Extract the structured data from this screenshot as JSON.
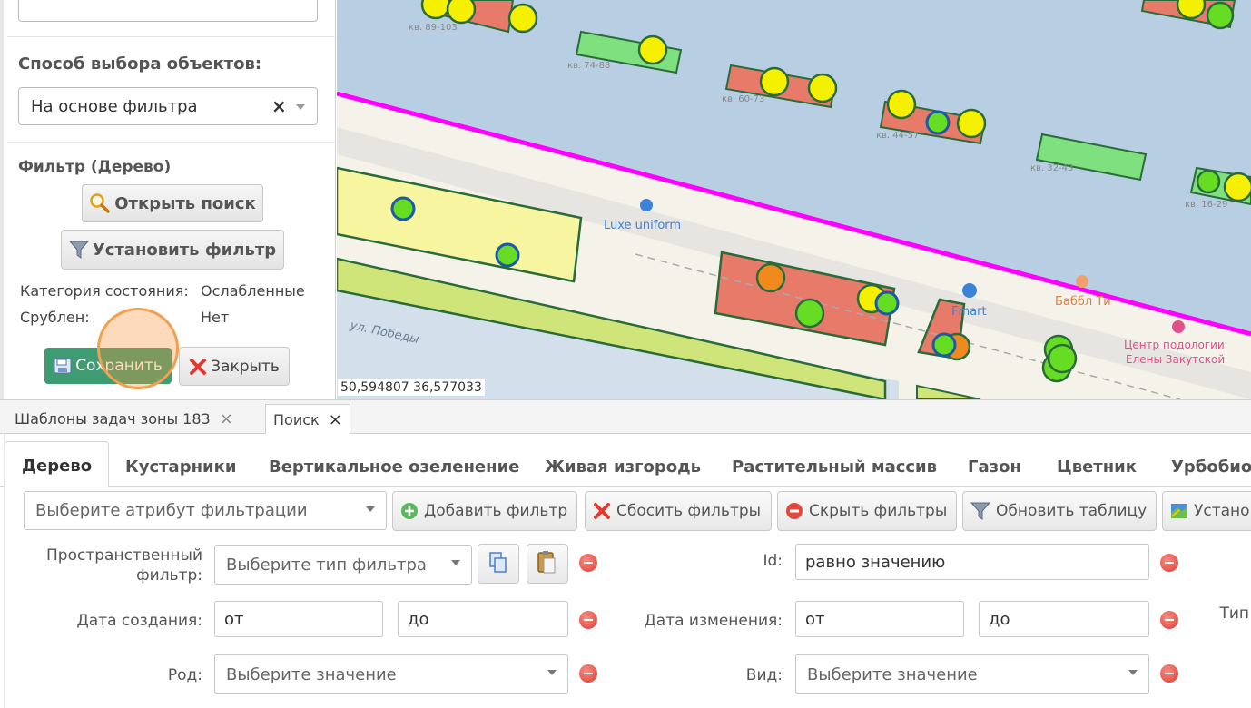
{
  "left_panel": {
    "selection_method_title": "Способ выбора объектов:",
    "selection_method_value": "На основе фильтра",
    "selection_method_clear": "×",
    "filter_title": "Фильтр (Дерево)",
    "open_search_label": "Открыть поиск",
    "set_filter_label": "Установить фильтр",
    "state_category_key": "Категория состояния:",
    "state_category_value": "Ослабленные",
    "cut_key": "Срублен:",
    "cut_value": "Нет",
    "save_label": "Сохранить",
    "close_label": "Закрыть"
  },
  "map": {
    "coordinates": "50,594807 36,577033",
    "poi": [
      "Luxe uniform",
      "Fmart",
      "Баббл Ти",
      "Центр подологии",
      "Елены Закутской"
    ],
    "street": "ул. Победы",
    "flat_labels": [
      "кв. 89-103",
      "кв. 74-88",
      "кв. 60-73",
      "кв. 44-57",
      "кв. 32-43",
      "кв. 16-29"
    ],
    "colors": {
      "boundary": "#ff00ff",
      "tree_green": "#66dd22",
      "tree_yellow": "#f5f000",
      "tree_orange": "#f08a1c",
      "polygon_red": "#e87a6a",
      "polygon_green": "#7ee07e",
      "polygon_yellow": "#f7f5a0"
    }
  },
  "tabs": [
    {
      "label": "Шаблоны задач зоны 183",
      "close": "×"
    },
    {
      "label": "Поиск",
      "close": "×"
    }
  ],
  "search": {
    "categories": [
      "Дерево",
      "Кустарники",
      "Вертикальное озеленение",
      "Живая изгородь",
      "Растительный массив",
      "Газон",
      "Цветник",
      "Урбобио"
    ],
    "attribute_placeholder": "Выберите атрибут фильтрации",
    "buttons": {
      "add_filter": "Добавить фильтр",
      "reset_filters": "Сбосить фильтры",
      "hide_filters": "Скрыть фильтры",
      "refresh_table": "Обновить таблицу",
      "install": "Устано"
    },
    "filters": {
      "spatial_label_1": "Пространственный",
      "spatial_label_2": "фильтр:",
      "spatial_placeholder": "Выберите тип фильтра",
      "id_label": "Id:",
      "id_value": "равно значению",
      "created_label": "Дата создания:",
      "created_from": "от",
      "created_to": "до",
      "modified_label": "Дата изменения:",
      "modified_from": "от",
      "modified_to": "до",
      "type_label": "Тип",
      "genus_label": "Род:",
      "genus_placeholder": "Выберите значение",
      "species_label": "Вид:",
      "species_placeholder": "Выберите значение"
    }
  }
}
